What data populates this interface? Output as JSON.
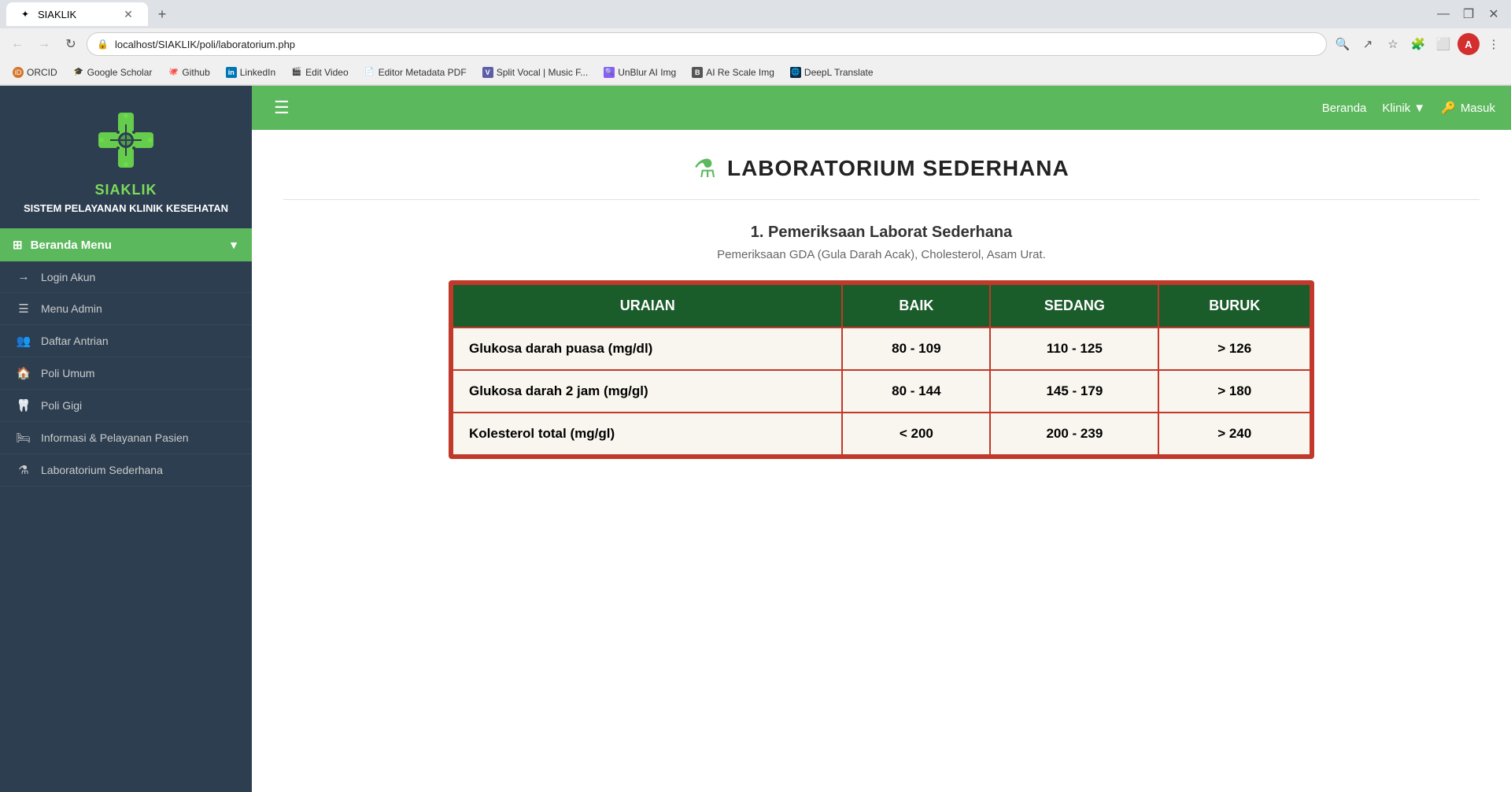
{
  "browser": {
    "tab_title": "SIAKLIK",
    "tab_favicon": "✦",
    "url": "localhost/SIAKLIK/poli/laboratorium.php",
    "new_tab_label": "+",
    "window_controls": {
      "minimize": "—",
      "maximize": "❐",
      "close": "✕"
    },
    "nav": {
      "back": "←",
      "forward": "→",
      "reload": "↻"
    }
  },
  "bookmarks": [
    {
      "label": "ORCID",
      "favicon": "🆔",
      "color": "#d4742a"
    },
    {
      "label": "Google Scholar",
      "favicon": "🎓",
      "color": "#4285F4"
    },
    {
      "label": "Github",
      "favicon": "🐙",
      "color": "#333"
    },
    {
      "label": "LinkedIn",
      "favicon": "in",
      "color": "#0077b5"
    },
    {
      "label": "Edit Video",
      "favicon": "🎬",
      "color": "#7b5ea7"
    },
    {
      "label": "Editor Metadata PDF",
      "favicon": "📄",
      "color": "#5c8dd6"
    },
    {
      "label": "Split Vocal | Music F...",
      "favicon": "V",
      "color": "#5c5ea7"
    },
    {
      "label": "UnBlur AI Img",
      "favicon": "🔍",
      "color": "#8b5cf6"
    },
    {
      "label": "AI Re Scale Img",
      "favicon": "B",
      "color": "#555"
    },
    {
      "label": "DeepL Translate",
      "favicon": "🌐",
      "color": "#0f2b46"
    }
  ],
  "sidebar": {
    "logo_alt": "SIAKLIK logo",
    "title": "SIAKLIK",
    "subtitle": "SISTEM PELAYANAN KLINIK\nKESEHATAN",
    "menu_header": "Beranda Menu",
    "nav_items": [
      {
        "icon": "→",
        "icon_name": "login-icon",
        "label": "Login Akun"
      },
      {
        "icon": "☰",
        "icon_name": "admin-icon",
        "label": "Menu Admin"
      },
      {
        "icon": "👥",
        "icon_name": "queue-icon",
        "label": "Daftar Antrian"
      },
      {
        "icon": "🏠",
        "icon_name": "poli-umum-icon",
        "label": "Poli Umum"
      },
      {
        "icon": "🦷",
        "icon_name": "poli-gigi-icon",
        "label": "Poli Gigi"
      },
      {
        "icon": "🛏",
        "icon_name": "info-pelayanan-icon",
        "label": "Informasi & Pelayanan Pasien"
      },
      {
        "icon": "⚗",
        "icon_name": "laboratorium-icon",
        "label": "Laboratorium Sederhana"
      }
    ]
  },
  "navbar": {
    "hamburger": "☰",
    "beranda": "Beranda",
    "klinik": "Klinik",
    "masuk": "Masuk",
    "masuk_icon": "→"
  },
  "page": {
    "title": "LABORATORIUM SEDERHANA",
    "lab_icon": "⚗",
    "section_number": "1.",
    "section_title": "Pemeriksaan Laborat Sederhana",
    "section_subtitle": "Pemeriksaan GDA (Gula Darah Acak), Cholesterol, Asam Urat.",
    "table": {
      "headers": [
        "URAIAN",
        "BAIK",
        "SEDANG",
        "BURUK"
      ],
      "rows": [
        {
          "uraian": "Glukosa darah puasa (mg/dl)",
          "baik": "80 - 109",
          "sedang": "110 - 125",
          "buruk": "> 126"
        },
        {
          "uraian": "Glukosa darah 2 jam (mg/gl)",
          "baik": "80 - 144",
          "sedang": "145 - 179",
          "buruk": "> 180"
        },
        {
          "uraian": "Kolesterol total (mg/gl)",
          "baik": "< 200",
          "sedang": "200 - 239",
          "buruk": "> 240"
        }
      ]
    }
  }
}
